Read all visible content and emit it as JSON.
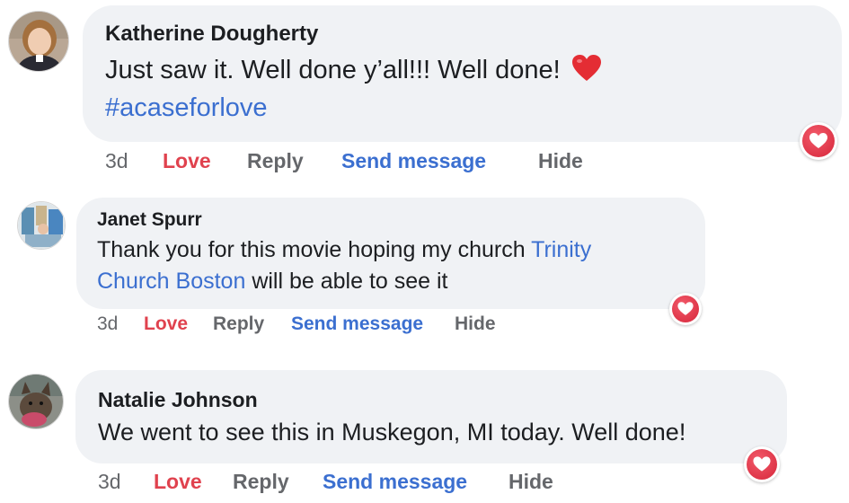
{
  "comments": [
    {
      "author": "Katherine Dougherty",
      "line1": "Just saw it. Well done y’all!!! Well done!",
      "emoji": "heart-emoji",
      "hashtag": "#acaseforlove",
      "time": "3d",
      "love": "Love",
      "reply": "Reply",
      "send": "Send message",
      "hide": "Hide",
      "reaction": "love-reaction-icon"
    },
    {
      "author": "Janet Spurr",
      "line1_pre": "Thank you for this movie hoping my church ",
      "line1_link": "Trinity",
      "line2_link": "Church Boston",
      "line2_post": " will be able to see it",
      "time": "3d",
      "love": "Love",
      "reply": "Reply",
      "send": "Send message",
      "hide": "Hide",
      "reaction": "love-reaction-icon"
    },
    {
      "author": "Natalie Johnson",
      "line1": "We went to see this in Muskegon, MI today. Well done!",
      "time": "3d",
      "love": "Love",
      "reply": "Reply",
      "send": "Send message",
      "hide": "Hide",
      "reaction": "love-reaction-icon"
    }
  ],
  "colors": {
    "bubble": "#f0f2f5",
    "link": "#3b6fd0",
    "love": "#e0424e",
    "meta": "#65676b",
    "text": "#1c1e21"
  }
}
